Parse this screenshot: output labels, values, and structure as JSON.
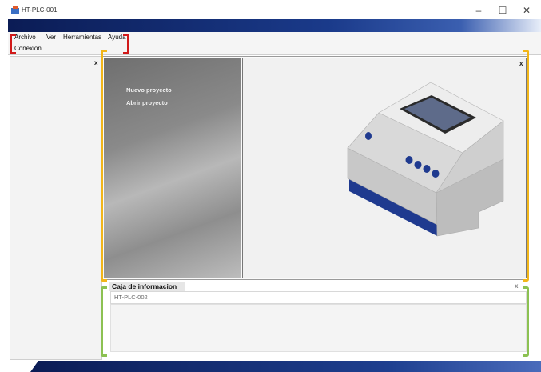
{
  "window": {
    "title": "HT-PLC-001",
    "minimize": "–",
    "maximize": "☐",
    "close": "✕"
  },
  "menu": {
    "items": [
      "Archivo",
      "Ver",
      "Herramientas",
      "Ayuda"
    ]
  },
  "toolbar": {
    "connection_label": "Conexion"
  },
  "sidepanel": {
    "close": "x"
  },
  "welcome": {
    "close": "x",
    "new_project": "Nuevo proyecto",
    "open_project": "Abrir proyecto"
  },
  "info": {
    "title": "Caja de informacion",
    "close": "x",
    "row_text": "HT-PLC-002"
  },
  "colors": {
    "annotation_red": "#d11a1a",
    "annotation_yellow": "#f2b619",
    "annotation_green": "#8cc152",
    "brand_blue": "#1a3a8a"
  }
}
